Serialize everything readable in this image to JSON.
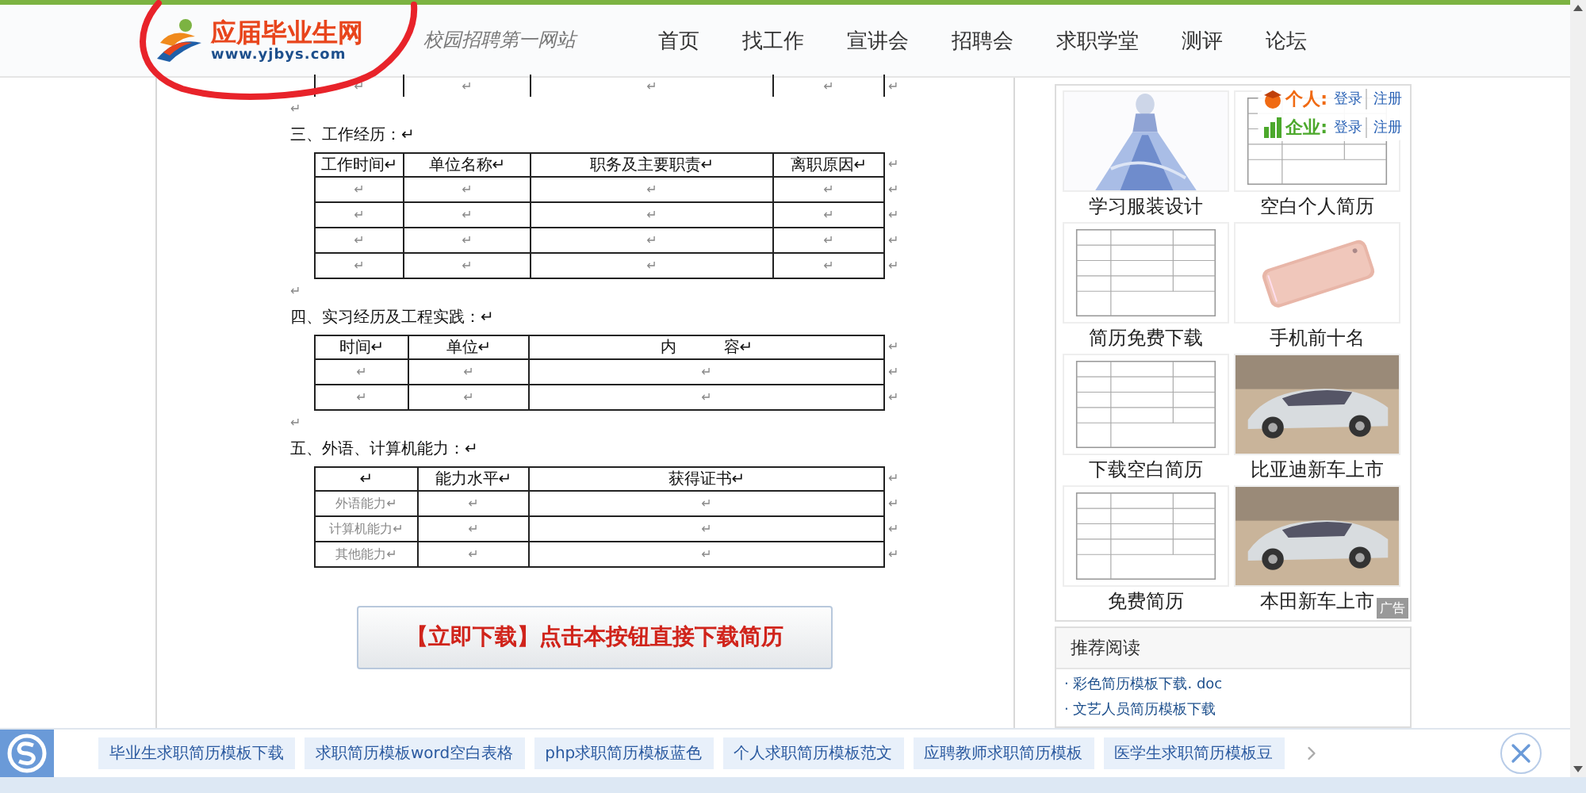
{
  "header": {
    "logo": {
      "name": "应届毕业生网",
      "url": "www.yjbys.com"
    },
    "slogan": "校园招聘第一网站",
    "nav": [
      "首页",
      "找工作",
      "宣讲会",
      "招聘会",
      "求职学堂",
      "测评",
      "论坛"
    ]
  },
  "document": [
    {
      "kind": "table",
      "rows": [
        {
          "header": false,
          "cells": [
            "↵",
            "↵",
            "↵",
            "↵"
          ],
          "end": "↵"
        }
      ]
    },
    {
      "kind": "mark",
      "text": "↵"
    },
    {
      "kind": "heading",
      "text": "三、工作经历：↵"
    },
    {
      "kind": "table",
      "rows": [
        {
          "header": true,
          "cells": [
            "工作时间↵",
            "单位名称↵",
            "职务及主要职责↵",
            "离职原因↵"
          ],
          "end": "↵"
        },
        {
          "header": false,
          "cells": [
            "↵",
            "↵",
            "↵",
            "↵"
          ],
          "end": "↵"
        },
        {
          "header": false,
          "cells": [
            "↵",
            "↵",
            "↵",
            "↵"
          ],
          "end": "↵"
        },
        {
          "header": false,
          "cells": [
            "↵",
            "↵",
            "↵",
            "↵"
          ],
          "end": "↵"
        },
        {
          "header": false,
          "cells": [
            "↵",
            "↵",
            "↵",
            "↵"
          ],
          "end": "↵"
        }
      ]
    },
    {
      "kind": "mark",
      "text": "↵"
    },
    {
      "kind": "heading",
      "text": "四、实习经历及工程实践：↵"
    },
    {
      "kind": "table",
      "rows": [
        {
          "header": true,
          "cells": [
            "时间↵",
            "单位↵",
            "内　　　容↵"
          ],
          "end": "↵"
        },
        {
          "header": false,
          "cells": [
            "↵",
            "↵",
            "↵"
          ],
          "end": "↵"
        },
        {
          "header": false,
          "cells": [
            "↵",
            "↵",
            "↵"
          ],
          "end": "↵"
        }
      ]
    },
    {
      "kind": "mark",
      "text": "↵"
    },
    {
      "kind": "heading",
      "text": "五、外语、计算机能力：↵"
    },
    {
      "kind": "table",
      "rows": [
        {
          "header": true,
          "cells": [
            "↵",
            "能力水平↵",
            "获得证书↵"
          ],
          "end": "↵"
        },
        {
          "header": false,
          "cells": [
            "外语能力↵",
            "↵",
            "↵"
          ],
          "end": "↵"
        },
        {
          "header": false,
          "cells": [
            "计算机能力↵",
            "↵",
            "↵"
          ],
          "end": "↵"
        },
        {
          "header": false,
          "cells": [
            "其他能力↵",
            "↵",
            "↵"
          ],
          "end": "↵"
        }
      ]
    }
  ],
  "download_button": "【立即下载】点击本按钮直接下载简历",
  "sidebar": {
    "login": [
      {
        "kind": "person",
        "label": "个人:",
        "links": [
          "登录",
          "注册"
        ]
      },
      {
        "kind": "company",
        "label": "企业:",
        "links": [
          "登录",
          "注册"
        ]
      }
    ],
    "ads": [
      {
        "kind": "dress",
        "caption": "学习服装设计"
      },
      {
        "kind": "form",
        "caption": "空白个人简历"
      },
      {
        "kind": "form",
        "caption": "简历免费下载"
      },
      {
        "kind": "phone",
        "caption": "手机前十名"
      },
      {
        "kind": "form",
        "caption": "下载空白简历"
      },
      {
        "kind": "car",
        "caption": "比亚迪新车上市"
      },
      {
        "kind": "form",
        "caption": "免费简历"
      },
      {
        "kind": "car",
        "caption": "本田新车上市"
      }
    ],
    "ad_badge": "广告",
    "recommended": {
      "title": "推荐阅读",
      "links": [
        "· 彩色简历模板下载. doc",
        "· 文艺人员简历模板下载"
      ]
    }
  },
  "bottom_bar": {
    "chips": [
      "毕业生求职简历模板下载",
      "求职简历模板word空白表格",
      "php求职简历模板蓝色",
      "个人求职简历模板范文",
      "应聘教师求职简历模板",
      "医学生求职简历模板豆"
    ]
  }
}
